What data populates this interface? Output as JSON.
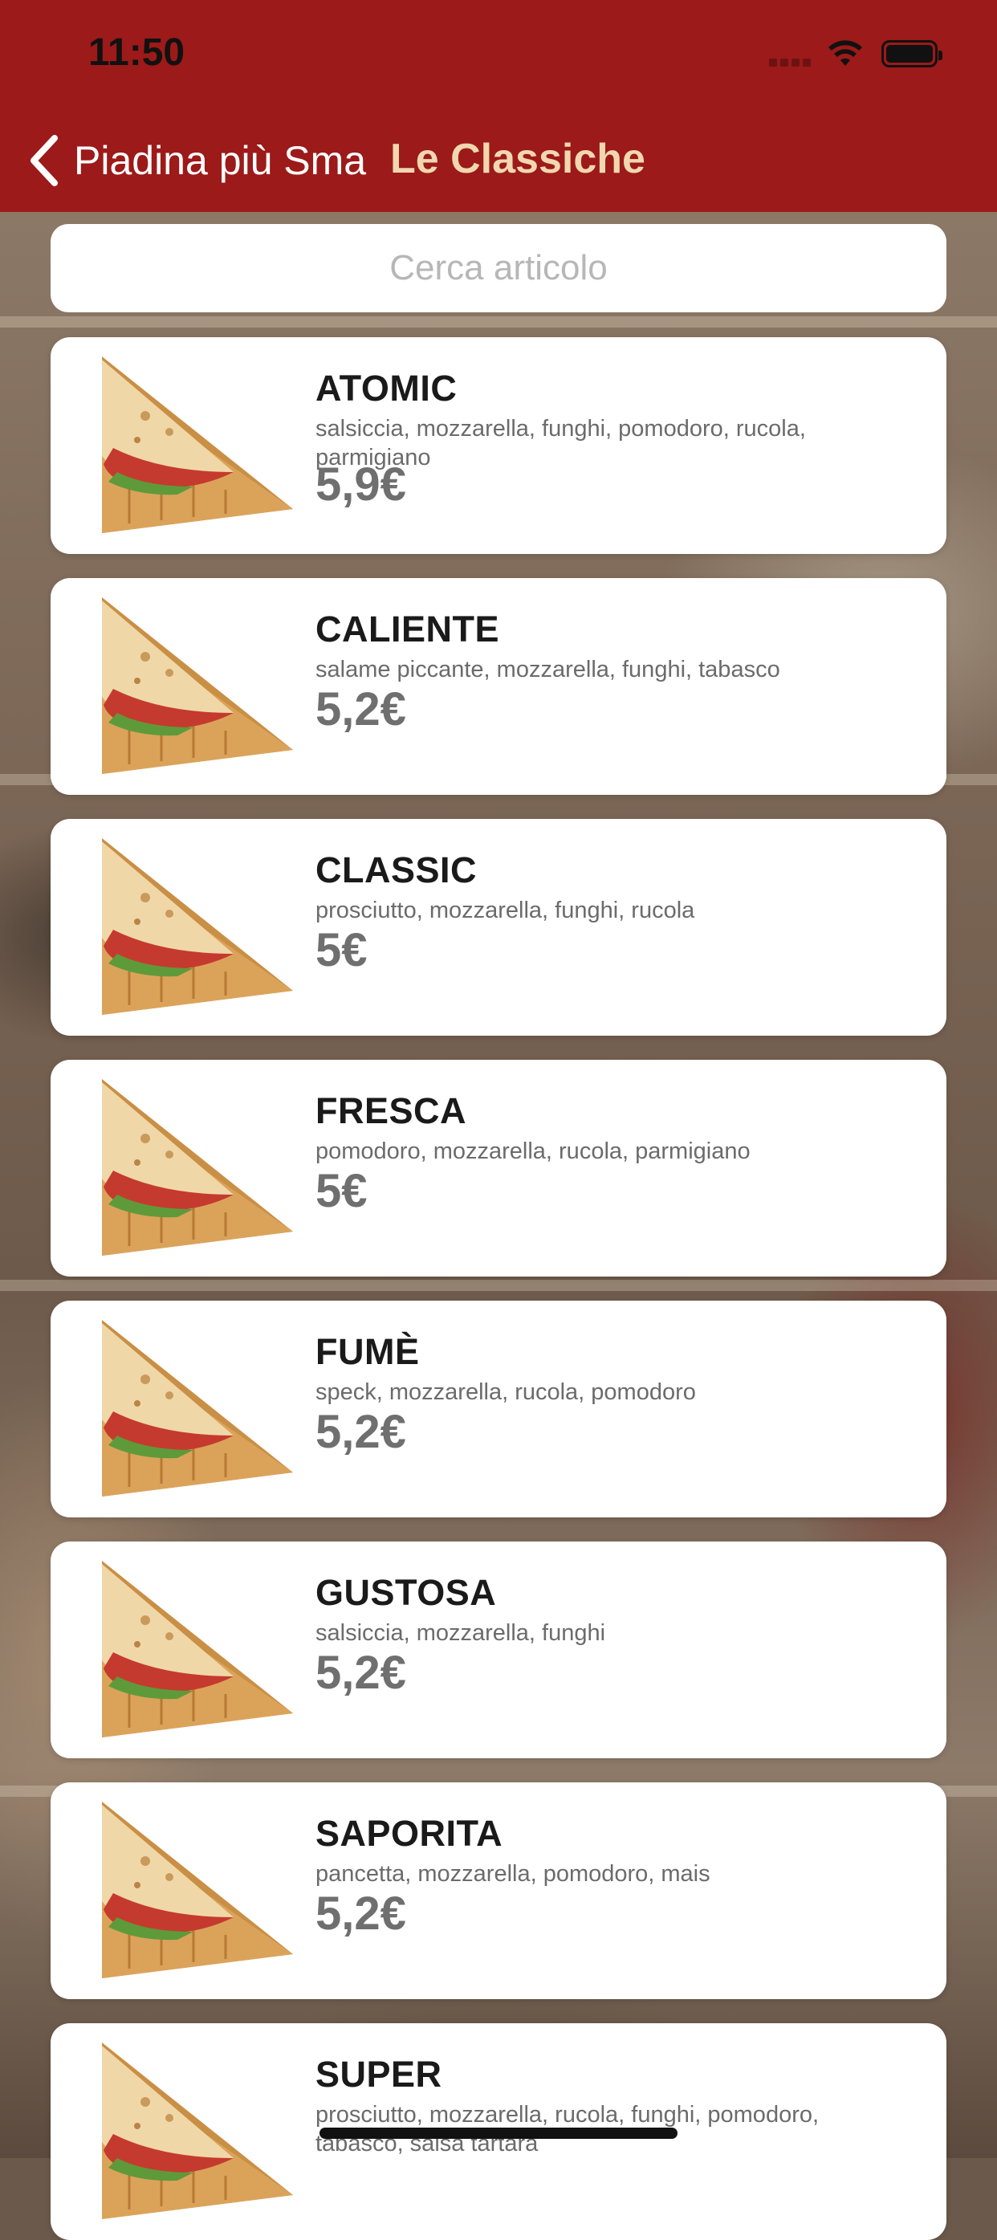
{
  "status_bar": {
    "time": "11:50"
  },
  "nav": {
    "back_label": "Piadina più Sma",
    "title": "Le Classiche"
  },
  "search": {
    "placeholder": "Cerca articolo"
  },
  "products": [
    {
      "name": "ATOMIC",
      "description": "salsiccia, mozzarella, funghi, pomodoro, rucola, parmigiano",
      "price": "5,9€"
    },
    {
      "name": "CALIENTE",
      "description": "salame piccante, mozzarella, funghi, tabasco",
      "price": "5,2€"
    },
    {
      "name": "CLASSIC",
      "description": "prosciutto, mozzarella, funghi, rucola",
      "price": "5€"
    },
    {
      "name": "FRESCA",
      "description": "pomodoro, mozzarella, rucola, parmigiano",
      "price": "5€"
    },
    {
      "name": "FUMÈ",
      "description": "speck, mozzarella, rucola, pomodoro",
      "price": "5,2€"
    },
    {
      "name": "GUSTOSA",
      "description": "salsiccia, mozzarella, funghi",
      "price": "5,2€"
    },
    {
      "name": "SAPORITA",
      "description": "pancetta, mozzarella, pomodoro, mais",
      "price": "5,2€"
    },
    {
      "name": "SUPER",
      "description": "prosciutto, mozzarella, rucola, funghi, pomodoro, tabasco, salsa tartara",
      "price": ""
    }
  ],
  "colors": {
    "nav_bar": "#9c1a19",
    "nav_title": "#f1d7b0",
    "price_text": "#6f6f6f"
  },
  "icons": {
    "back": "chevron-left-icon",
    "product_image": "piadina-icon"
  }
}
